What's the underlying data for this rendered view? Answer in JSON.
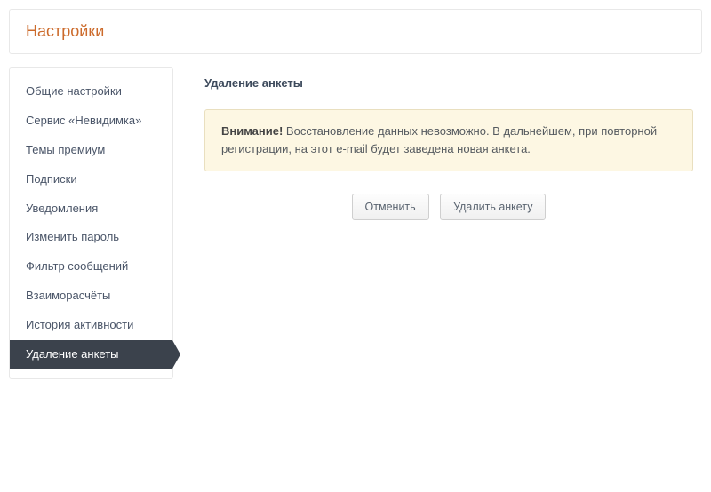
{
  "page": {
    "title": "Настройки"
  },
  "sidebar": {
    "items": [
      {
        "label": "Общие настройки",
        "active": false
      },
      {
        "label": "Сервис «Невидимка»",
        "active": false
      },
      {
        "label": "Темы премиум",
        "active": false
      },
      {
        "label": "Подписки",
        "active": false
      },
      {
        "label": "Уведомления",
        "active": false
      },
      {
        "label": "Изменить пароль",
        "active": false
      },
      {
        "label": "Фильтр сообщений",
        "active": false
      },
      {
        "label": "Взаиморасчёты",
        "active": false
      },
      {
        "label": "История активности",
        "active": false
      },
      {
        "label": "Удаление анкеты",
        "active": true
      }
    ]
  },
  "content": {
    "title": "Удаление анкеты",
    "alert": {
      "strong": "Внимание!",
      "text": " Восстановление данных невозможно. В дальнейшем, при повторной регистрации, на этот e-mail будет заведена новая анкета."
    },
    "buttons": {
      "cancel": "Отменить",
      "delete": "Удалить анкету"
    }
  }
}
